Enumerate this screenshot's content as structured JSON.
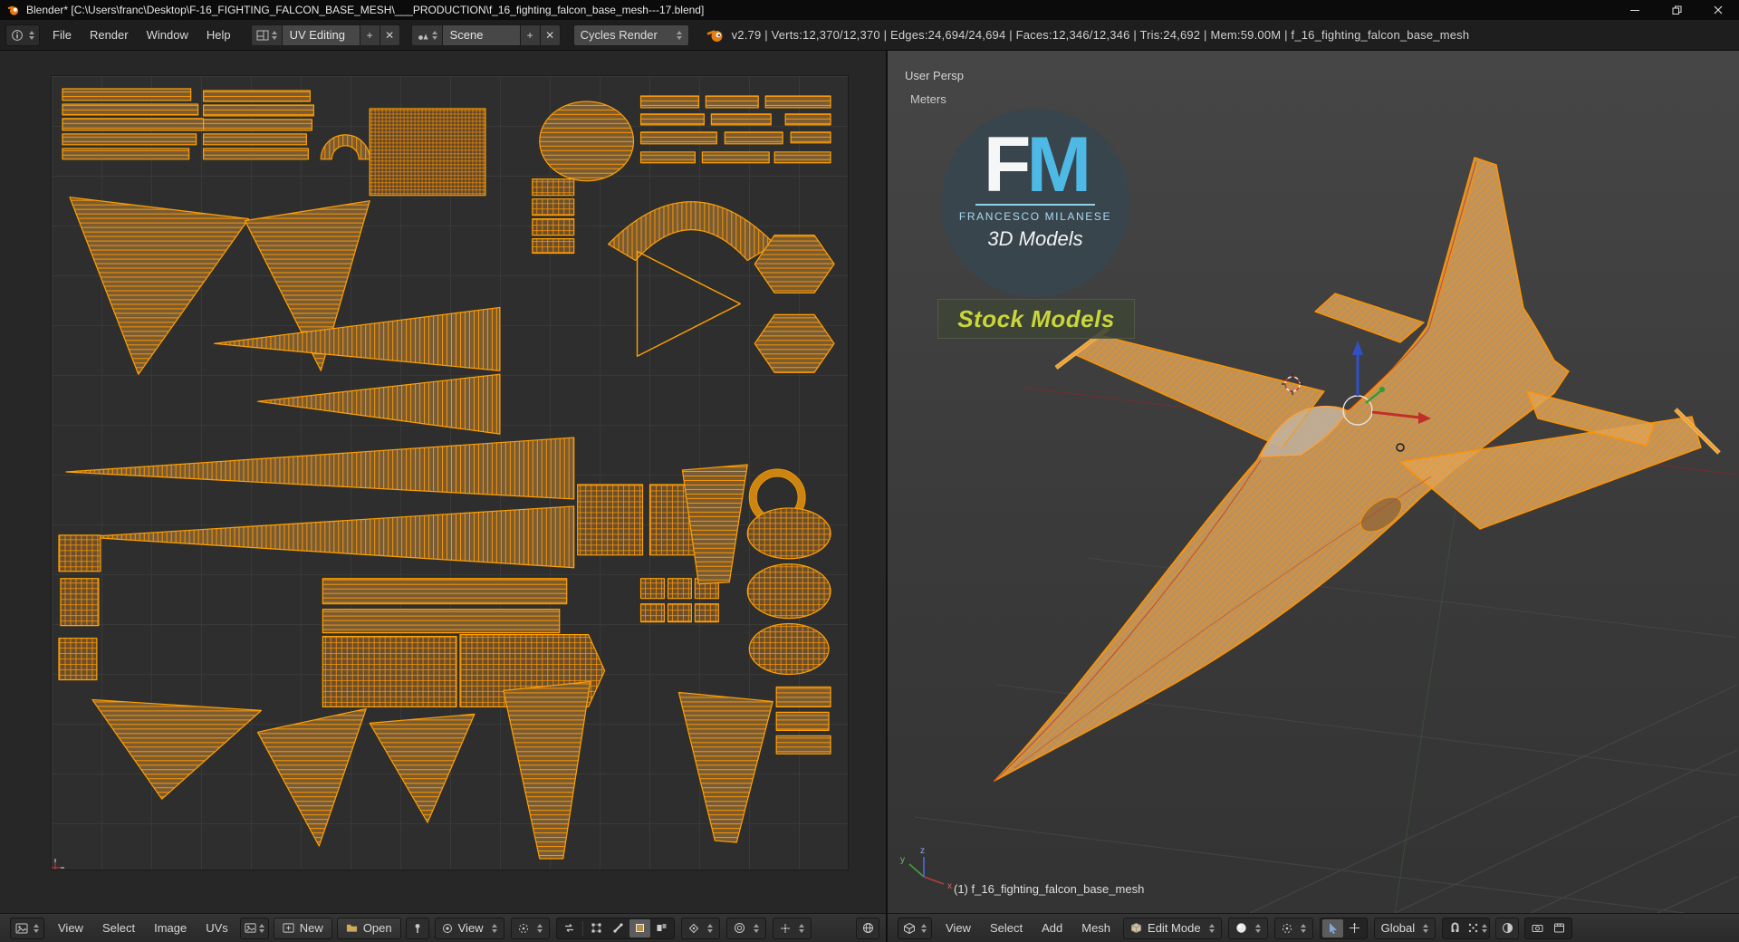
{
  "window": {
    "title": "Blender* [C:\\Users\\franc\\Desktop\\F-16_FIGHTING_FALCON_BASE_MESH\\___PRODUCTION\\f_16_fighting_falcon_base_mesh---17.blend]"
  },
  "icons": {
    "plus": "+",
    "close": "✕"
  },
  "infobar": {
    "menus": [
      "File",
      "Render",
      "Window",
      "Help"
    ],
    "layout": {
      "value": "UV Editing"
    },
    "scene": {
      "value": "Scene"
    },
    "engine": {
      "value": "Cycles Render"
    },
    "stats": "v2.79 | Verts:12,370/12,370 | Edges:24,694/24,694 | Faces:12,346/12,346 | Tris:24,692 | Mem:59.00M | f_16_fighting_falcon_base_mesh"
  },
  "uv_editor": {
    "menus": [
      "View",
      "Select",
      "Image",
      "UVs"
    ],
    "new_button": "New",
    "open_button": "Open",
    "mode": {
      "value": "View"
    }
  },
  "viewport": {
    "view_label": "User Persp",
    "units_label": "Meters",
    "object_info": "(1) f_16_fighting_falcon_base_mesh",
    "menus": [
      "View",
      "Select",
      "Add",
      "Mesh"
    ],
    "mode": {
      "value": "Edit Mode"
    },
    "orientation": {
      "value": "Global"
    },
    "axis_labels": {
      "x": "x",
      "y": "y",
      "z": "z"
    },
    "logo": {
      "initial_f": "F",
      "initial_m": "M",
      "name": "FRANCESCO MILANESE",
      "tagline": "3D Models",
      "badge": "Stock Models"
    }
  },
  "colors": {
    "uv_wire": "#ff9600",
    "selected_face": "#7a5c33",
    "accent_blue": "#4fb9e6",
    "badge_text": "#c9d63a"
  }
}
